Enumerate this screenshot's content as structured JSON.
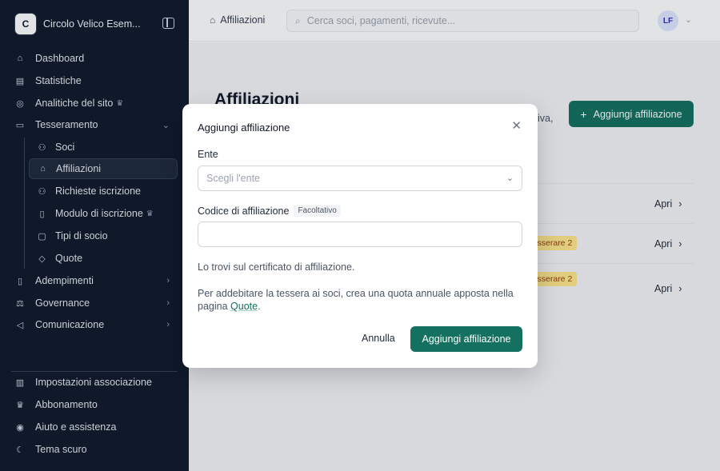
{
  "org": {
    "initial": "C",
    "name": "Circolo Velico Esem..."
  },
  "sidebar": {
    "items": [
      {
        "label": "Dashboard",
        "icon": "home-icon"
      },
      {
        "label": "Statistiche",
        "icon": "chart-icon"
      },
      {
        "label": "Analitiche del sito",
        "icon": "globe-icon",
        "premium": true
      },
      {
        "label": "Tesseramento",
        "icon": "card-icon",
        "expanded": true
      }
    ],
    "sub_items": [
      {
        "label": "Soci",
        "icon": "users-icon"
      },
      {
        "label": "Affiliazioni",
        "icon": "bank-icon",
        "active": true
      },
      {
        "label": "Richieste iscrizione",
        "icon": "user-plus-icon"
      },
      {
        "label": "Modulo di iscrizione",
        "icon": "form-icon",
        "premium": true
      },
      {
        "label": "Tipi di socio",
        "icon": "tag-icon"
      },
      {
        "label": "Quote",
        "icon": "price-tag-icon"
      }
    ],
    "more_items": [
      {
        "label": "Adempimenti",
        "icon": "document-icon"
      },
      {
        "label": "Governance",
        "icon": "scale-icon"
      },
      {
        "label": "Comunicazione",
        "icon": "megaphone-icon"
      }
    ],
    "footer_items": [
      {
        "label": "Impostazioni associazione",
        "icon": "building-icon"
      },
      {
        "label": "Abbonamento",
        "icon": "crown-icon"
      },
      {
        "label": "Aiuto e assistenza",
        "icon": "lifebuoy-icon"
      },
      {
        "label": "Tema scuro",
        "icon": "moon-icon"
      }
    ]
  },
  "topbar": {
    "breadcrumb": "Affiliazioni",
    "search_placeholder": "Cerca soci, pagamenti, ricevute...",
    "avatar_initials": "LF"
  },
  "page": {
    "title": "Affiliazioni",
    "desc_fragment": "iva,",
    "add_button": "Aggiungi affiliazione",
    "rows": [
      {
        "action": "Apri"
      },
      {
        "action": "Apri",
        "badge": "a tesserare 2"
      },
      {
        "action": "Apri",
        "badge": "a tesserare 2"
      }
    ]
  },
  "modal": {
    "title": "Aggiungi affiliazione",
    "ente_label": "Ente",
    "ente_placeholder": "Scegli l'ente",
    "code_label": "Codice di affiliazione",
    "code_optional": "Facoltativo",
    "code_value": "",
    "hint_certificate": "Lo trovi sul certificato di affiliazione.",
    "hint_quote_line1": "Per addebitare la tessera ai soci, crea una quota annuale apposta nella",
    "hint_quote_prefix": "pagina ",
    "hint_quote_link": "Quote",
    "hint_quote_suffix": ".",
    "cancel_label": "Annulla",
    "submit_label": "Aggiungi affiliazione"
  },
  "colors": {
    "brand": "#14705f",
    "sidebar_bg": "#0f1a2b"
  }
}
